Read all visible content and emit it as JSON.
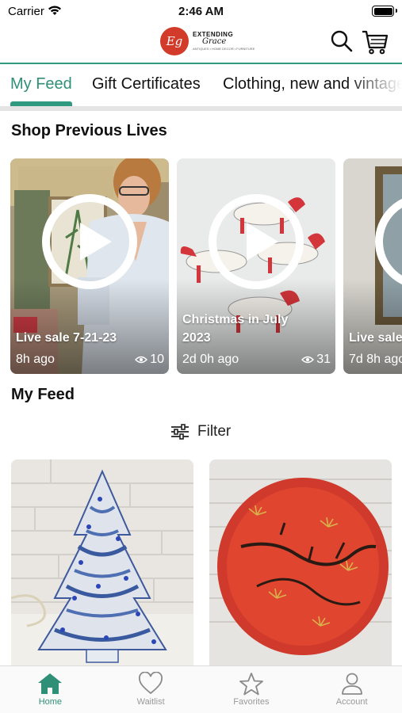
{
  "status_bar": {
    "carrier": "Carrier",
    "time": "2:46 AM"
  },
  "header": {
    "logo_monogram": "Eg",
    "logo_line1": "EXTENDING",
    "logo_line2": "Grace",
    "logo_line3": "ANTIQUES • HOME DECOR • FURNITURE"
  },
  "tabs": [
    {
      "label": "My Feed",
      "active": true
    },
    {
      "label": "Gift Certificates",
      "active": false
    },
    {
      "label": "Clothing, new and vintage",
      "active": false
    }
  ],
  "previous_lives": {
    "title": "Shop Previous Lives",
    "cards": [
      {
        "title": "Live sale 7-21-23",
        "time": "8h ago",
        "views": "10"
      },
      {
        "title": "Christmas in July 2023",
        "time": "2d 0h ago",
        "views": "31"
      },
      {
        "title": "Live sale",
        "time": "7d 8h ago",
        "views": ""
      }
    ]
  },
  "feed": {
    "title": "My Feed",
    "filter_label": "Filter"
  },
  "bottom_nav": [
    {
      "label": "Home",
      "icon": "home-icon",
      "active": true
    },
    {
      "label": "Waitlist",
      "icon": "heart-icon",
      "active": false
    },
    {
      "label": "Favorites",
      "icon": "star-icon",
      "active": false
    },
    {
      "label": "Account",
      "icon": "person-icon",
      "active": false
    }
  ],
  "colors": {
    "accent": "#2f8f77",
    "brand_red": "#d23a2a"
  }
}
